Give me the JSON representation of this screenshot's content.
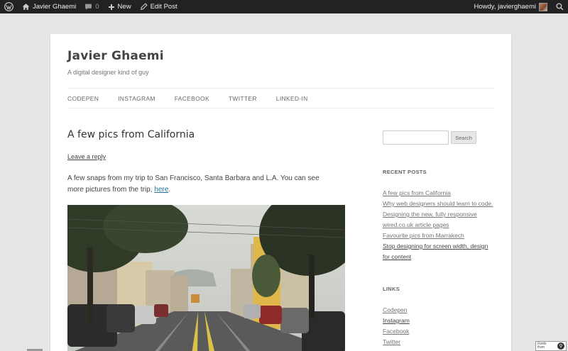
{
  "adminbar": {
    "site_name": "Javier Ghaemi",
    "comments_count": "0",
    "new_label": "New",
    "edit_label": "Edit Post",
    "greeting": "Howdy, javierghaemi"
  },
  "header": {
    "title": "Javier Ghaemi",
    "description": "A digital designer kind of guy"
  },
  "nav": {
    "items": [
      "CODEPEN",
      "INSTAGRAM",
      "FACEBOOK",
      "TWITTER",
      "LINKED-IN"
    ]
  },
  "post": {
    "title": "A few pics from California",
    "leave_reply": "Leave a reply",
    "text_before": "A few snaps from my trip to San Francisco, Santa Barbara and L.A. You can see more pictures from the trip, ",
    "link_text": "here",
    "text_after": "."
  },
  "sidebar": {
    "search_button": "Search",
    "search_placeholder": "",
    "recent_title": "RECENT POSTS",
    "recent_posts": [
      "A few pics from California",
      "Why web designers should learn to code.",
      "Designing the new, fully responsive wired.co.uk article pages",
      "Favourite pics from Marrakech",
      "Stop designing for screen width, design for content"
    ],
    "links_title": "LINKS",
    "links": [
      "Codepen",
      "Instagram",
      "Facebook",
      "Twitter"
    ]
  },
  "badge": {
    "line1": "Fonts",
    "line2": "from"
  },
  "colors": {
    "adminbar_bg": "#222222",
    "link_blue": "#21759b",
    "page_bg": "#e6e6e6"
  },
  "icons": [
    "wordpress-icon",
    "home-icon",
    "comment-icon",
    "plus-icon",
    "edit-icon",
    "search-icon"
  ]
}
